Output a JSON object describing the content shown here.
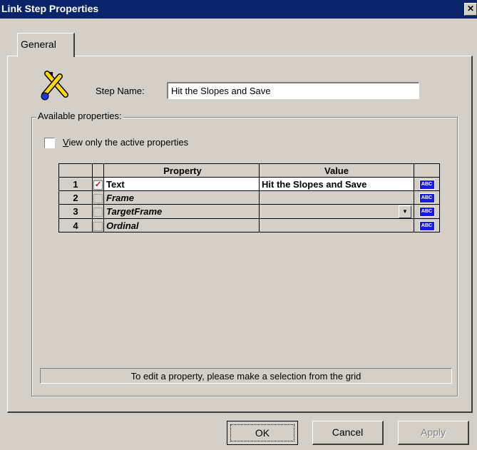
{
  "window": {
    "title": "Link Step Properties",
    "close_label": "✕"
  },
  "tabs": [
    {
      "label": "General"
    }
  ],
  "step": {
    "label": "Step Name:",
    "value": "Hit the Slopes and Save"
  },
  "group": {
    "label": "Available properties:"
  },
  "filter": {
    "label": "View only the active properties",
    "checked": false
  },
  "grid": {
    "headers": {
      "property": "Property",
      "value": "Value"
    },
    "rows": [
      {
        "num": "1",
        "property": "Text",
        "value": "Hit the Slopes and Save",
        "active": true,
        "badge": "ABC"
      },
      {
        "num": "2",
        "property": "Frame",
        "value": "",
        "active": false,
        "badge": "ABC"
      },
      {
        "num": "3",
        "property": "TargetFrame",
        "value": "",
        "active": false,
        "badge": "ABC",
        "has_dropdown": true
      },
      {
        "num": "4",
        "property": "Ordinal",
        "value": "",
        "active": false,
        "badge": "ABC"
      }
    ]
  },
  "status": {
    "text": "To edit a property, please make a selection from the grid"
  },
  "buttons": {
    "ok": "OK",
    "cancel": "Cancel",
    "apply": "Apply"
  },
  "icons": {
    "step": "link-step-icon",
    "close": "close-icon",
    "dropdown": "chevron-down-icon",
    "text_type": "abc-icon"
  }
}
